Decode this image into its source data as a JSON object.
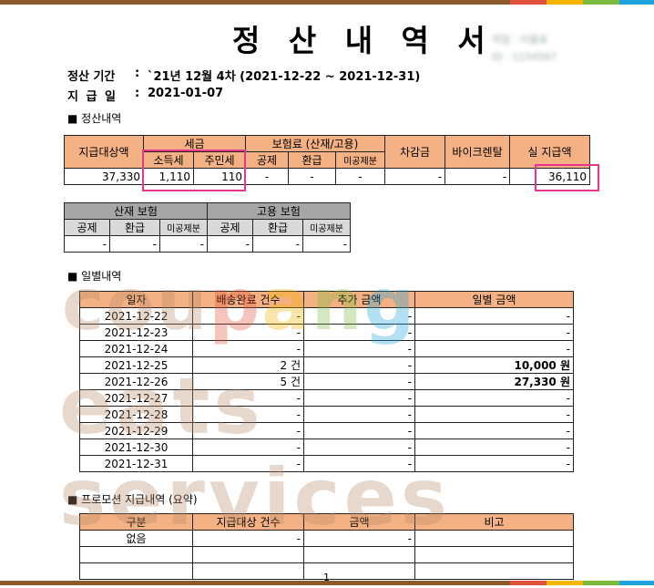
{
  "header": {
    "title": "정 산 내 역 서",
    "blur_line1": "작업 : 이름표",
    "blur_line2": "ID : 1234567"
  },
  "period": {
    "label": "정산 기간",
    "value": "`21년 12월 4차 (2021-12-22 ~ 2021-12-31)"
  },
  "paydate": {
    "label": "지 급 일",
    "value": "2021-01-07"
  },
  "sections": {
    "settle": "■ 정산내역",
    "daily": "■ 일별내역",
    "promo": "■ 프로모션 지급내역 (요약)"
  },
  "settle": {
    "h_target": "지급대상액",
    "h_tax": "세금",
    "h_income_tax": "소득세",
    "h_resident_tax": "주민세",
    "h_insurance": "보험료 (산재/고용)",
    "h_deduct": "공제",
    "h_refund": "환급",
    "h_undeducted": "미공제분",
    "h_diff": "차감금",
    "h_bike": "바이크렌탈",
    "h_net": "실 지급액",
    "v_target": "37,330",
    "v_income_tax": "1,110",
    "v_resident_tax": "110",
    "v_deduct": "-",
    "v_refund": "-",
    "v_undeducted": "-",
    "v_diff": "-",
    "v_bike": "-",
    "v_net": "36,110"
  },
  "insurance": {
    "h_accident": "산재 보험",
    "h_employ": "고용 보험",
    "h_deduct": "공제",
    "h_refund": "환급",
    "h_undeducted": "미공제분",
    "values": [
      "-",
      "-",
      "-",
      "-",
      "-",
      "-"
    ]
  },
  "daily": {
    "headers": [
      "일자",
      "배송완료 건수",
      "추가 금액",
      "일별 금액"
    ],
    "rows": [
      [
        "2021-12-22",
        "-",
        "-",
        "-"
      ],
      [
        "2021-12-23",
        "-",
        "-",
        "-"
      ],
      [
        "2021-12-24",
        "-",
        "-",
        "-"
      ],
      [
        "2021-12-25",
        "2 건",
        "-",
        "10,000 원"
      ],
      [
        "2021-12-26",
        "5 건",
        "-",
        "27,330 원"
      ],
      [
        "2021-12-27",
        "-",
        "-",
        "-"
      ],
      [
        "2021-12-28",
        "-",
        "-",
        "-"
      ],
      [
        "2021-12-29",
        "-",
        "-",
        "-"
      ],
      [
        "2021-12-30",
        "-",
        "-",
        "-"
      ],
      [
        "2021-12-31",
        "-",
        "-",
        "-"
      ]
    ]
  },
  "promo": {
    "headers": [
      "구분",
      "지급대상 건수",
      "금액",
      "비고"
    ],
    "rows": [
      [
        "없음",
        "-",
        "-",
        ""
      ],
      [
        "",
        "",
        "",
        ""
      ],
      [
        "",
        "",
        "",
        ""
      ]
    ]
  },
  "page_number": "1",
  "watermark": {
    "line1": [
      "c",
      "o",
      "u",
      "p",
      "a",
      "n",
      "g"
    ],
    "line2": "eats services"
  },
  "colors": {
    "header_orange": "#f4b183",
    "header_gray": "#a6a6a6",
    "highlight": "#e6378a",
    "bar": [
      "#8b5a2b",
      "#e0513b",
      "#f5b400",
      "#7cba3d",
      "#1ea3dc"
    ]
  }
}
